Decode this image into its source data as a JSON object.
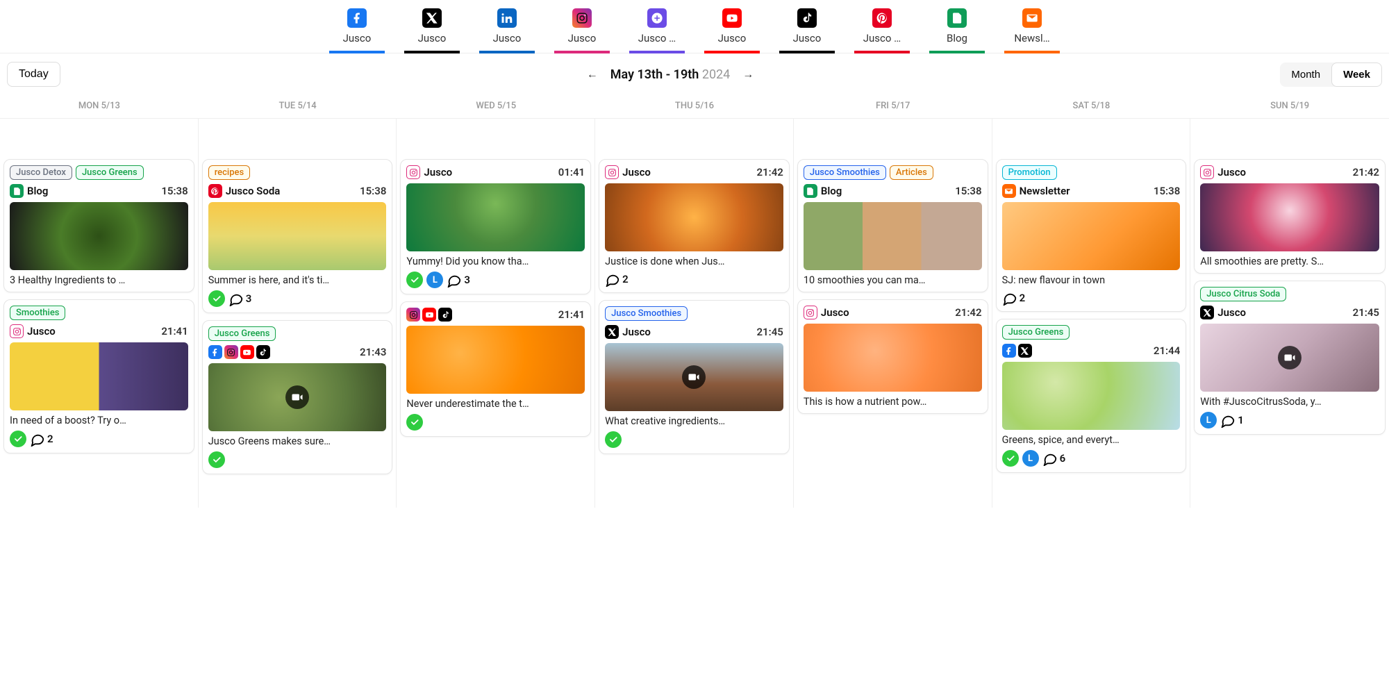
{
  "channels": [
    {
      "label": "Jusco",
      "platform": "fb",
      "underline": "#1877f2"
    },
    {
      "label": "Jusco",
      "platform": "x",
      "underline": "#000"
    },
    {
      "label": "Jusco",
      "platform": "li",
      "underline": "#0a66c2"
    },
    {
      "label": "Jusco",
      "platform": "ig",
      "underline": "#dd2a7b"
    },
    {
      "label": "Jusco …",
      "platform": "gb",
      "underline": "#6b4ce6"
    },
    {
      "label": "Jusco",
      "platform": "yt",
      "underline": "#ff0000"
    },
    {
      "label": "Jusco",
      "platform": "tt",
      "underline": "#000"
    },
    {
      "label": "Jusco …",
      "platform": "pin",
      "underline": "#e60023"
    },
    {
      "label": "Blog",
      "platform": "blog",
      "underline": "#0f9d58"
    },
    {
      "label": "Newsl…",
      "platform": "nl",
      "underline": "#ff6600"
    }
  ],
  "toolbar": {
    "today": "Today",
    "range": "May 13th - 19th",
    "year": "2024",
    "month": "Month",
    "week": "Week"
  },
  "days": [
    {
      "label": "MON 5/13"
    },
    {
      "label": "TUE 5/14"
    },
    {
      "label": "WED 5/15"
    },
    {
      "label": "THU 5/16"
    },
    {
      "label": "FRI 5/17"
    },
    {
      "label": "SAT 5/18"
    },
    {
      "label": "SUN 5/19"
    }
  ],
  "columns": [
    [
      {
        "tags": [
          {
            "text": "Jusco Detox",
            "color": "#6b7280",
            "bg": "#f3f4f6"
          },
          {
            "text": "Jusco Greens",
            "color": "#16a34a",
            "bg": "#ecfdf5"
          }
        ],
        "platforms": [
          "blog"
        ],
        "account": "Blog",
        "time": "15:38",
        "thumb": "spinach",
        "caption": "3 Healthy Ingredients to …"
      },
      {
        "tags": [
          {
            "text": "Smoothies",
            "color": "#16a34a",
            "bg": "#ecfdf5"
          }
        ],
        "platforms": [
          "ig-line"
        ],
        "account": "Jusco",
        "time": "21:41",
        "thumb": "bottle",
        "caption": "In need of a boost? Try o…",
        "status": {
          "green": true,
          "comments": 2
        }
      }
    ],
    [
      {
        "tags": [
          {
            "text": "recipes",
            "color": "#d97706",
            "bg": "#fffbeb"
          }
        ],
        "platforms": [
          "pin"
        ],
        "account": "Jusco Soda",
        "time": "15:38",
        "thumb": "lemonade",
        "caption": "Summer is here, and it's ti…",
        "status": {
          "green": true,
          "comments": 3
        }
      },
      {
        "tags": [
          {
            "text": "Jusco Greens",
            "color": "#16a34a",
            "bg": "#ecfdf5"
          }
        ],
        "platforms": [
          "fb",
          "ig",
          "yt",
          "tt"
        ],
        "account": "",
        "time": "21:43",
        "thumb": "avocado",
        "video": true,
        "caption": "Jusco Greens makes sure…",
        "status": {
          "green": true
        }
      }
    ],
    [
      {
        "platforms": [
          "ig-line"
        ],
        "account": "Jusco",
        "time": "01:41",
        "thumb": "kiwi",
        "caption": "Yummy! Did you know tha…",
        "status": {
          "green": true,
          "blue": true,
          "comments": 3
        }
      },
      {
        "platforms": [
          "ig",
          "yt",
          "tt"
        ],
        "account": "",
        "time": "21:41",
        "thumb": "oranges",
        "caption": "Never underestimate the t…",
        "status": {
          "green": true
        }
      }
    ],
    [
      {
        "platforms": [
          "ig-line"
        ],
        "account": "Jusco",
        "time": "21:42",
        "thumb": "citrus",
        "caption": "Justice is done when Jus…",
        "status": {
          "comments": 2
        }
      },
      {
        "tags": [
          {
            "text": "Jusco Smoothies",
            "color": "#2563eb",
            "bg": "#eff6ff"
          }
        ],
        "platforms": [
          "x"
        ],
        "account": "Jusco",
        "time": "21:45",
        "thumb": "smoothies",
        "video": true,
        "caption": "What creative ingredients…",
        "status": {
          "green": true
        }
      }
    ],
    [
      {
        "tags": [
          {
            "text": "Jusco Smoothies",
            "color": "#2563eb",
            "bg": "#eff6ff"
          },
          {
            "text": "Articles",
            "color": "#d97706",
            "bg": "#fffbeb"
          }
        ],
        "platforms": [
          "blog"
        ],
        "account": "Blog",
        "time": "15:38",
        "thumb": "trio",
        "caption": "10 smoothies you can ma…"
      },
      {
        "platforms": [
          "ig-line"
        ],
        "account": "Jusco",
        "time": "21:42",
        "thumb": "peach",
        "caption": "This is how a nutrient pow…"
      }
    ],
    [
      {
        "tags": [
          {
            "text": "Promotion",
            "color": "#06b6d4",
            "bg": "#ecfeff"
          }
        ],
        "platforms": [
          "nl"
        ],
        "account": "Newsletter",
        "time": "15:38",
        "thumb": "mango",
        "caption": "SJ: new flavour in town",
        "status": {
          "comments": 2
        }
      },
      {
        "tags": [
          {
            "text": "Jusco Greens",
            "color": "#16a34a",
            "bg": "#ecfdf5"
          }
        ],
        "platforms": [
          "fb",
          "x"
        ],
        "account": "",
        "time": "21:44",
        "thumb": "limes",
        "caption": "Greens, spice, and everyt…",
        "status": {
          "green": true,
          "blue": true,
          "comments": 6
        }
      }
    ],
    [
      {
        "platforms": [
          "ig-line"
        ],
        "account": "Jusco",
        "time": "21:42",
        "thumb": "berries",
        "caption": "All smoothies are pretty. S…"
      },
      {
        "tags": [
          {
            "text": "Jusco Citrus Soda",
            "color": "#16a34a",
            "bg": "#ecfdf5"
          }
        ],
        "platforms": [
          "x"
        ],
        "account": "Jusco",
        "time": "21:45",
        "thumb": "soda",
        "video": true,
        "caption": "With #JuscoCitrusSoda, y…",
        "status": {
          "blue": true,
          "comments": 1
        }
      }
    ]
  ]
}
